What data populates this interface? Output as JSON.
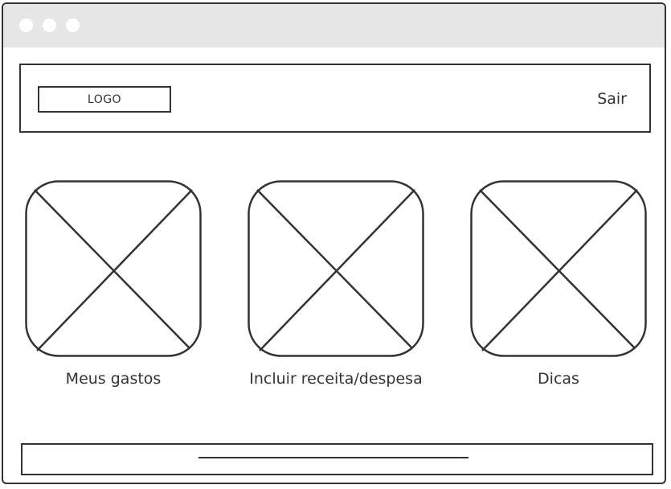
{
  "header": {
    "logo_text": "LOGO",
    "logout_label": "Sair"
  },
  "cards": [
    {
      "label": "Meus gastos",
      "icon": "image-placeholder-icon"
    },
    {
      "label": "Incluir receita/despesa",
      "icon": "image-placeholder-icon"
    },
    {
      "label": "Dicas",
      "icon": "image-placeholder-icon"
    }
  ],
  "colors": {
    "stroke": "#333333",
    "titlebar": "#e6e6e6",
    "background": "#ffffff"
  }
}
